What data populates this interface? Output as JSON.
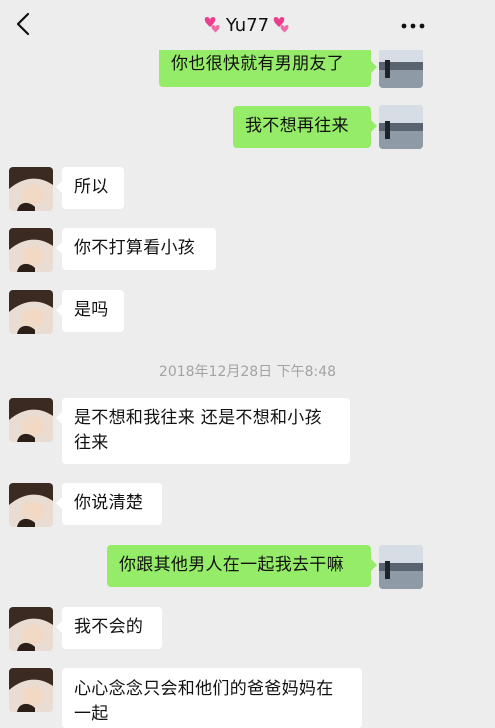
{
  "header": {
    "title": "Yu77",
    "back_icon": "chevron-left-icon",
    "more_icon": "ellipsis-icon",
    "title_decor_icon": "two-hearts-icon",
    "heart_color": "#e83e8c"
  },
  "colors": {
    "background": "#ededed",
    "incoming_bubble": "#ffffff",
    "outgoing_bubble": "#95ec69",
    "timestamp": "#a3a3a3"
  },
  "messages": [
    {
      "side": "out",
      "text": "你也很快就有男朋友了"
    },
    {
      "side": "out",
      "text": "我不想再往来"
    },
    {
      "side": "in",
      "text": "所以"
    },
    {
      "side": "in",
      "text": "你不打算看小孩"
    },
    {
      "side": "in",
      "text": "是吗"
    },
    {
      "type": "time",
      "text": "2018年12月28日 下午8:48"
    },
    {
      "side": "in",
      "text": "是不想和我往来 还是不想和小孩往来"
    },
    {
      "side": "in",
      "text": "你说清楚"
    },
    {
      "side": "out",
      "text": "你跟其他男人在一起我去干嘛"
    },
    {
      "side": "in",
      "text": "我不会的"
    },
    {
      "side": "in",
      "text": "心心念念只会和他们的爸爸妈妈在一起"
    }
  ]
}
